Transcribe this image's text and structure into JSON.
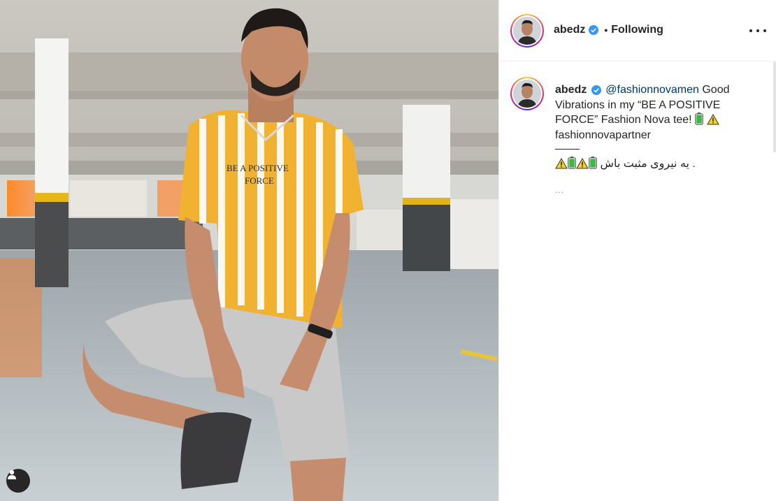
{
  "post": {
    "username": "abedz",
    "verified": true,
    "separator": "•",
    "follow_status": "Following",
    "more_options": "More options"
  },
  "caption": {
    "username": "abedz",
    "mention": "@fashionnovamen",
    "text_part1": " Good Vibrations in my “BE A POSITIVE FORCE” Fashion Nova tee! ",
    "tag_line": "fashionnovapartner",
    "persian_text": ". یه نیروی مثبت باش",
    "continuation": "..."
  },
  "photo": {
    "shirt_print_line1": "BE A POSITIVE",
    "shirt_print_line2": "FORCE"
  },
  "icons": {
    "battery_emoji_color": "#3fb54a",
    "warning_emoji_color": "#f7d21e",
    "verified_color": "#3897f0",
    "user_tag": "person-icon"
  }
}
